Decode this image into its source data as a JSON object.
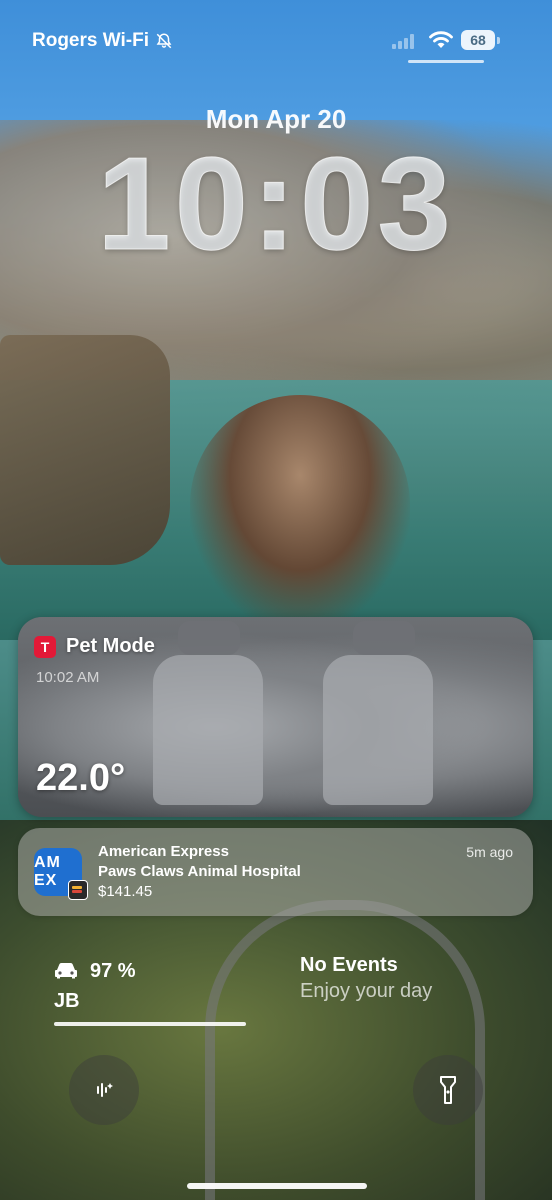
{
  "status_bar": {
    "carrier": "Rogers Wi-Fi",
    "battery_level": "68",
    "mute_icon": "bell-slash-icon",
    "wifi_icon": "wifi-icon"
  },
  "lock_screen": {
    "date": "Mon Apr 20",
    "time": "10:03"
  },
  "camera_widget": {
    "app_icon": "tesla-logo-icon",
    "app_icon_letter": "T",
    "title": "Pet Mode",
    "timestamp": "10:02 AM",
    "temperature": "22.0°",
    "accent_color": "#e31937"
  },
  "notification": {
    "app_icon_text": "AM EX",
    "app_name": "American Express",
    "merchant": "Paws Claws Animal Hospital",
    "amount": "$141.45",
    "time_ago": "5m ago",
    "icon_color": "#1f6fd0"
  },
  "car_widget": {
    "icon": "car-icon",
    "battery_percent": "97 %",
    "label": "JB",
    "charge_fraction": 1.0
  },
  "calendar_widget": {
    "title": "No Events",
    "subtitle": "Enjoy your day"
  },
  "controls": {
    "left_icon": "voice-waveform-icon",
    "right_icon": "flashlight-icon"
  }
}
